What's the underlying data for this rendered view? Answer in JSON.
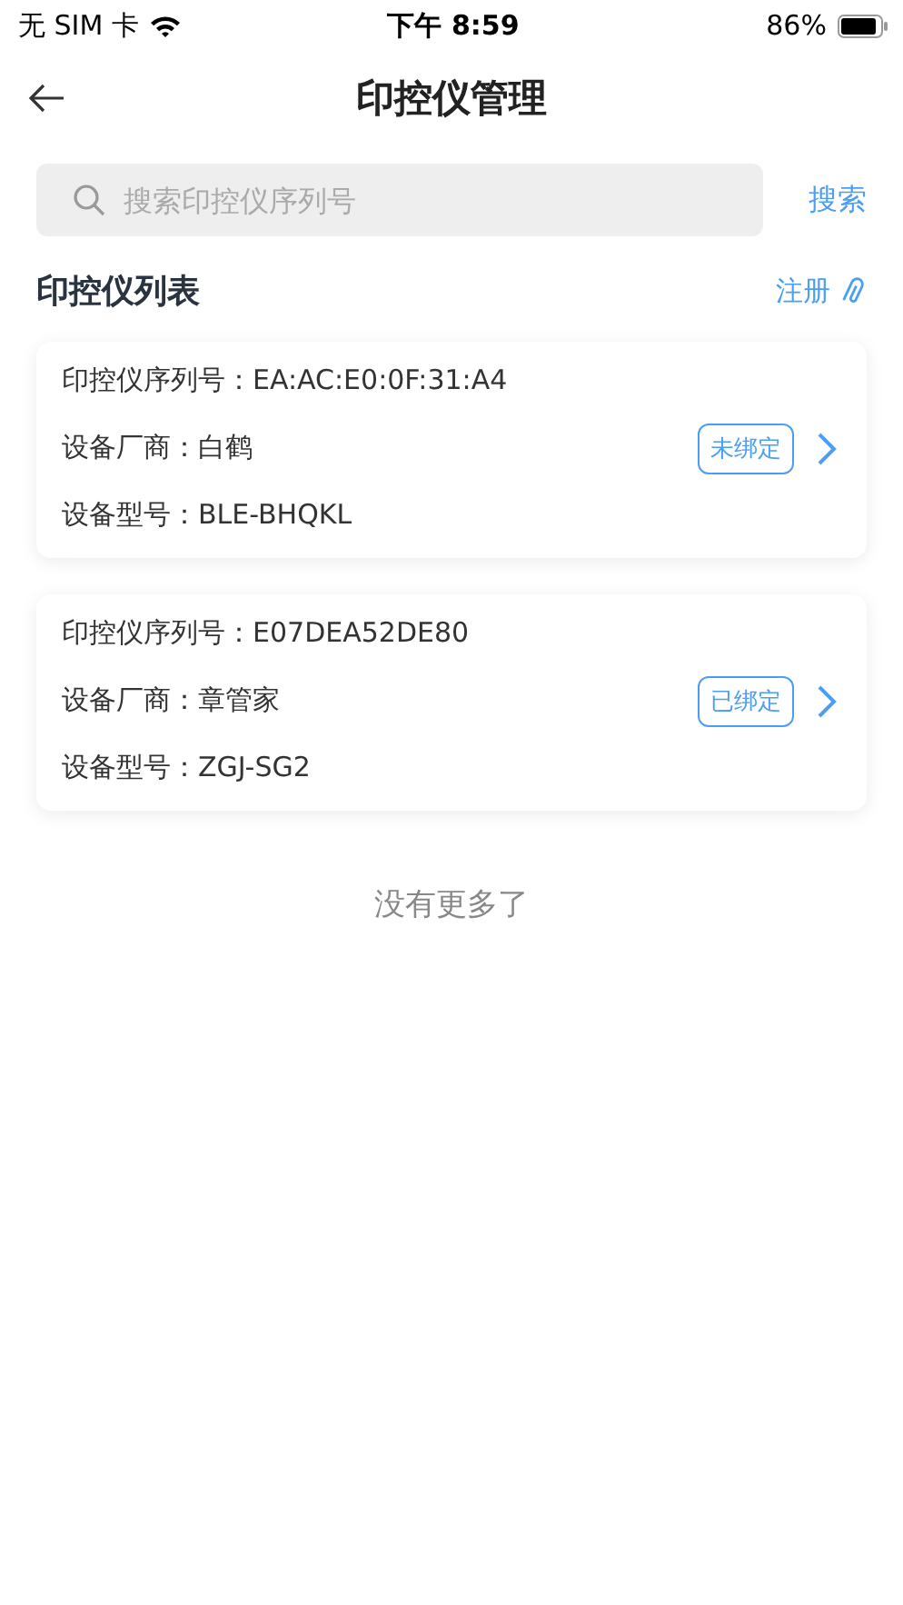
{
  "status_bar": {
    "carrier": "无 SIM 卡",
    "time": "下午 8:59",
    "battery": "86%"
  },
  "nav": {
    "title": "印控仪管理"
  },
  "search": {
    "placeholder": "搜索印控仪序列号",
    "button": "搜索"
  },
  "section": {
    "title": "印控仪列表",
    "action": "注册"
  },
  "devices": [
    {
      "fields": [
        {
          "label": "印控仪序列号：",
          "value": "EA:AC:E0:0F:31:A4"
        },
        {
          "label": "设备厂商：",
          "value": "白鹤"
        },
        {
          "label": "设备型号：",
          "value": "BLE-BHQKL"
        }
      ],
      "status": "未绑定"
    },
    {
      "fields": [
        {
          "label": "印控仪序列号：",
          "value": "E07DEA52DE80"
        },
        {
          "label": "设备厂商：",
          "value": "章管家"
        },
        {
          "label": "设备型号：",
          "value": "ZGJ-SG2"
        }
      ],
      "status": "已绑定"
    }
  ],
  "footer": "没有更多了"
}
